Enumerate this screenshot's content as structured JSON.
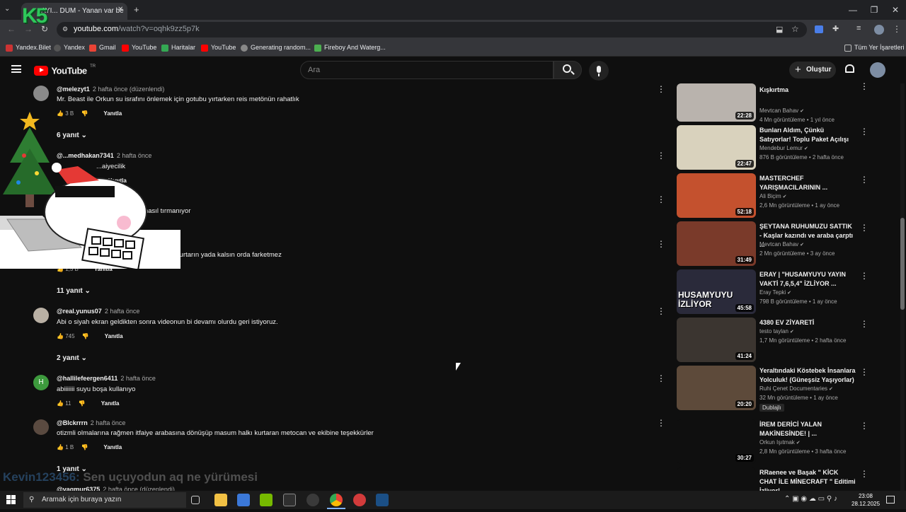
{
  "browser": {
    "tab_title": "AYI... DUM - Yanan var be",
    "url_host": "youtube.com",
    "url_path": "/watch?v=oqhk9zz5p7k",
    "bookmarks": [
      "Yandex.Bilet",
      "Yandex",
      "Gmail",
      "YouTube",
      "Haritalar",
      "YouTube",
      "Generating random...",
      "Fireboy And Waterg..."
    ],
    "all_bookmarks": "Tüm Yer İşaretleri"
  },
  "youtube": {
    "logo_text": "YouTube",
    "logo_region": "TR",
    "search_placeholder": "Ara",
    "create_label": "Oluştur"
  },
  "overlay": {
    "k5_text": "K5",
    "chat_user": "Kevin123456:",
    "chat_text": "Sen uçuyodun aq ne yürümesi"
  },
  "comments": [
    {
      "author": "@melezyt1",
      "time": "2 hafta önce (düzenlendi)",
      "text": "Mr. Beast ile Orkun su israfını önlemek  için gotubu yırtarken reis metönün rahatlık",
      "likes": "3 B",
      "reply": "Yanıtla",
      "replies": "6 yanıt"
    },
    {
      "author": "@...medhakan7341",
      "time": "2 hafta önce",
      "text": "...aiyecilik",
      "likes": "",
      "reply": "Yanıtla",
      "replies": ""
    },
    {
      "author": "",
      "time": "",
      "text": "...nasıl tırmanıyor",
      "likes": "",
      "reply": "",
      "replies": ""
    },
    {
      "author": "",
      "time": "",
      "text": "...kurtarın yada kalsın orda farketmez",
      "likes": "1,5 B",
      "reply": "Yanıtla",
      "replies": "11 yanıt"
    },
    {
      "author": "@real.yunus07",
      "time": "2 hafta önce",
      "text": "Abi o siyah ekran geldikten sonra videonun bi devamı olurdu geri istiyoruz.",
      "likes": "745",
      "reply": "Yanıtla",
      "replies": "2 yanıt"
    },
    {
      "author": "@hallilefeergen6411",
      "time": "2 hafta önce",
      "text": "abiiiiiii suyu boşa kullanıyo",
      "likes": "11",
      "reply": "Yanıtla",
      "replies": ""
    },
    {
      "author": "@Blckrrrn",
      "time": "2 hafta önce",
      "text": "otizmli olmalarına rağmen itfaiye arabasına dönüşüp masum halkı kurtaran metocan ve ekibine teşekkürler",
      "likes": "1 B",
      "reply": "Yanıtla",
      "replies": "1 yanıt"
    },
    {
      "author": "@vagmur6375",
      "time": "2 hafta önce (düzenlendi)",
      "text": "",
      "likes": "",
      "reply": "",
      "replies": ""
    }
  ],
  "videos": [
    {
      "title": "Kışkırtma",
      "channel": "Mevtcan Bahav",
      "views": "4 Mn görüntüleme",
      "age": "1 yıl önce",
      "duration": "22:28",
      "thumb_color": "#b9b3ad"
    },
    {
      "title": "Bunları Aldım, Çünkü Satıyorlar! Toplu Paket Açılışı",
      "channel": "Mendebur Lemur",
      "views": "876 B görüntüleme",
      "age": "2 hafta önce",
      "duration": "22:47",
      "thumb_color": "#d9d2bd"
    },
    {
      "title": "MASTERCHEF YARIŞMACILARININ ...",
      "channel": "Ali Biçim",
      "views": "2,6 Mn görüntüleme",
      "age": "1 ay önce",
      "duration": "52:18",
      "thumb_color": "#c4512e"
    },
    {
      "title": "ŞEYTANA RUHUMUZU SATTIK - Kaşlar kazındı ve araba çarptı ...",
      "channel": "Mevtcan Bahav",
      "views": "2 Mn görüntüleme",
      "age": "3 ay önce",
      "duration": "31:49",
      "thumb_color": "#7a3a2a"
    },
    {
      "title": "ERAY | \"HUSAMYUYU YAYIN VAKTİ 7,6,5,4\" İZLİYOR ...",
      "channel": "Eray Tepki",
      "views": "798 B görüntüleme",
      "age": "1 ay önce",
      "duration": "45:58",
      "thumb_color": "#2a2a3a",
      "thumb_text": "HUSAMYUYU İZLİYOR"
    },
    {
      "title": "4380 EV ZİYARETİ",
      "channel": "testo taylan",
      "views": "1,7 Mn görüntüleme",
      "age": "2 hafta önce",
      "duration": "41:24",
      "thumb_color": "#3b3530"
    },
    {
      "title": "Yeraltındaki Köstebek İnsanlara Yolculuk! (Güneşsiz Yaşıyorlar)",
      "channel": "Ruhi Çenet Documentaries",
      "views": "32 Mn görüntüleme",
      "age": "1 ay önce",
      "duration": "20:20",
      "thumb_color": "#5d4a3a",
      "badge": "Dublajlı"
    },
    {
      "title": "İREM DERİCİ YALAN MAKİNESİNDE! | ...",
      "channel": "Orkun Işıtmak",
      "views": "2,8 Mn görüntüleme",
      "age": "3 hafta önce",
      "duration": "30:27",
      "thumb_color": "#0f0f0f"
    },
    {
      "title": "RRaenee ve Başak \" KİCK CHAT İLE MİNECRAFT \" Editimi İzliyor!",
      "channel": "",
      "views": "",
      "age": "",
      "duration": "",
      "thumb_color": "#0f0f0f"
    }
  ],
  "taskbar": {
    "search_placeholder": "Aramak için buraya yazın",
    "time": "23:08",
    "date": "28.12.2025"
  }
}
